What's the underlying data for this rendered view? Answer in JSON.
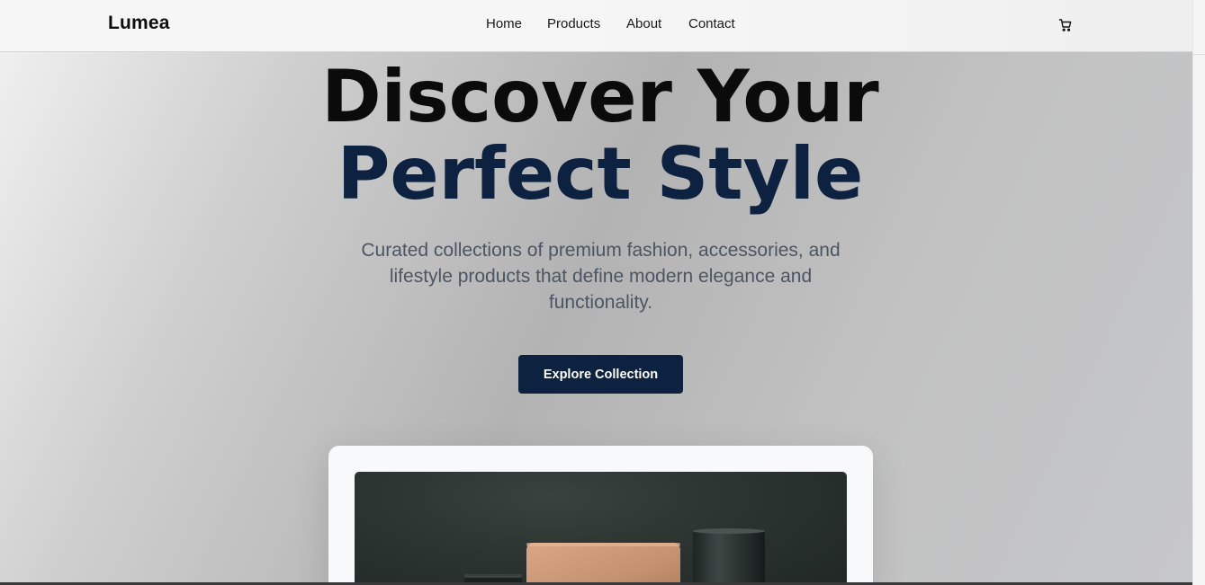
{
  "header": {
    "logo": "Lumea",
    "nav": [
      "Home",
      "Products",
      "About",
      "Contact"
    ],
    "cart_icon": "cart-icon"
  },
  "hero": {
    "title_line1": "Discover Your",
    "title_line2": "Perfect Style",
    "subtitle": "Curated collections of premium fashion, accessories, and lifestyle products that define modern elegance and functionality.",
    "cta_label": "Explore Collection"
  },
  "colors": {
    "brand_navy": "#0d2140",
    "heading_black": "#0b0b0b",
    "subtitle_gray": "#4b5563"
  }
}
